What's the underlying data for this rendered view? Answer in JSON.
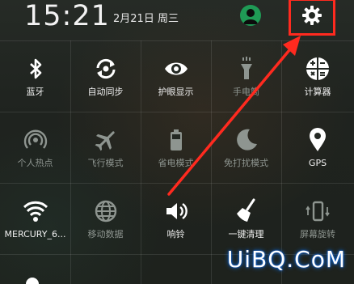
{
  "status": {
    "time": "15:21",
    "date": "2月21日 周三"
  },
  "colors": {
    "highlight": "#ff2a1f",
    "avatar_bg": "#1f9a55",
    "active_text": "#f0f0f0",
    "inactive_text": "#8e9590"
  },
  "tiles": [
    {
      "label": "蓝牙",
      "icon": "bluetooth-icon",
      "active": true
    },
    {
      "label": "自动同步",
      "icon": "sync-icon",
      "active": true
    },
    {
      "label": "护眼显示",
      "icon": "eye-icon",
      "active": true
    },
    {
      "label": "手电筒",
      "icon": "flashlight-icon",
      "active": false
    },
    {
      "label": "计算器",
      "icon": "calculator-icon",
      "active": true
    },
    {
      "label": "个人热点",
      "icon": "hotspot-icon",
      "active": false
    },
    {
      "label": "飞行模式",
      "icon": "airplane-icon",
      "active": false
    },
    {
      "label": "省电模式",
      "icon": "battery-icon",
      "active": false
    },
    {
      "label": "免打扰模式",
      "icon": "moon-icon",
      "active": false
    },
    {
      "label": "GPS",
      "icon": "location-pin-icon",
      "active": true
    },
    {
      "label": "MERCURY_6...",
      "icon": "wifi-icon",
      "active": true
    },
    {
      "label": "移动数据",
      "icon": "globe-icon",
      "active": false
    },
    {
      "label": "响铃",
      "icon": "speaker-icon",
      "active": true
    },
    {
      "label": "一键清理",
      "icon": "broom-icon",
      "active": true
    },
    {
      "label": "屏幕旋转",
      "icon": "rotate-icon",
      "active": false
    }
  ],
  "watermark": "UiBQ.CoM"
}
